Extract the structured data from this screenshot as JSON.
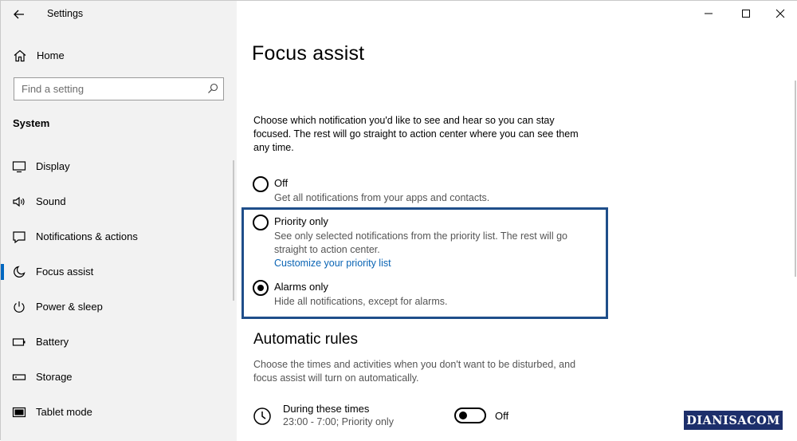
{
  "window": {
    "app_title": "Settings",
    "controls": [
      "minimize",
      "maximize",
      "close"
    ]
  },
  "sidebar": {
    "home_label": "Home",
    "search_placeholder": "Find a setting",
    "section": "System",
    "items": [
      {
        "label": "Display",
        "icon": "display-icon"
      },
      {
        "label": "Sound",
        "icon": "sound-icon"
      },
      {
        "label": "Notifications & actions",
        "icon": "notifications-icon"
      },
      {
        "label": "Focus assist",
        "icon": "moon-icon",
        "active": true
      },
      {
        "label": "Power & sleep",
        "icon": "power-icon"
      },
      {
        "label": "Battery",
        "icon": "battery-icon"
      },
      {
        "label": "Storage",
        "icon": "storage-icon"
      },
      {
        "label": "Tablet mode",
        "icon": "tablet-icon"
      }
    ]
  },
  "main": {
    "title": "Focus assist",
    "description": "Choose which notification you'd like to see and hear so you can stay focused. The rest will go straight to action center where you can see them any time.",
    "options": [
      {
        "label": "Off",
        "description": "Get all notifications from your apps and contacts.",
        "selected": false
      },
      {
        "label": "Priority only",
        "description": "See only selected notifications from the priority list. The rest will go straight to action center.",
        "link": "Customize your priority list",
        "selected": false
      },
      {
        "label": "Alarms only",
        "description": "Hide all notifications, except for alarms.",
        "selected": true
      }
    ],
    "automatic_rules": {
      "title": "Automatic rules",
      "description": "Choose the times and activities when you don't want to be disturbed, and focus assist will turn on automatically.",
      "rules": [
        {
          "name": "During these times",
          "detail": "23:00 - 7:00; Priority only",
          "toggle_label": "Off",
          "enabled": false
        }
      ]
    }
  },
  "watermark": "DIANISACOM",
  "colors": {
    "sidebar_bg": "#f2f2f2",
    "accent": "#0067c0",
    "link": "#0a64b4",
    "highlight_border": "#1f4e8a",
    "watermark_bg": "#1d2f6b"
  }
}
